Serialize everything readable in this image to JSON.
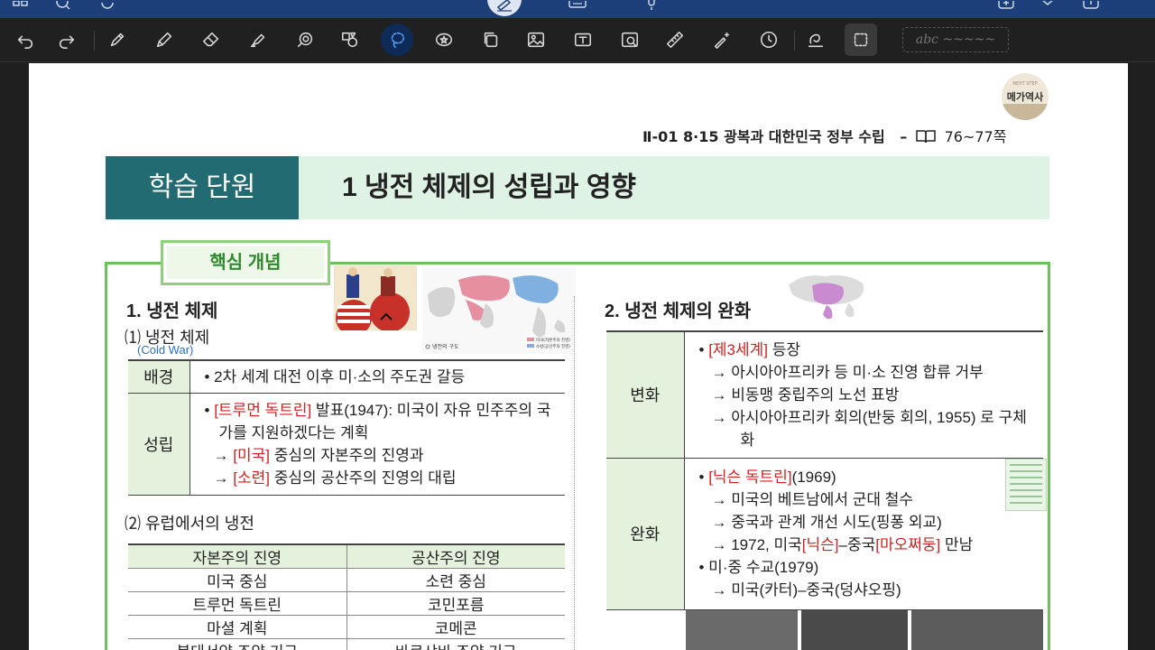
{
  "app": {
    "toolbar_placeholder": "abc ~~~~~",
    "icons": [
      "grid-icon",
      "search-icon",
      "rotate-icon",
      "pen-edit-icon",
      "doc-icon",
      "mic-icon",
      "add-page-icon",
      "bookmark-icon",
      "share-icon",
      "undo-icon",
      "redo-icon",
      "pen-icon",
      "pencil-icon",
      "eraser-icon",
      "highlighter-icon",
      "shape-icon",
      "shape-tools-icon",
      "lasso-icon",
      "sticker-icon",
      "copy-icon",
      "image-icon",
      "textbox-icon",
      "camera-image-icon",
      "ruler-icon",
      "laser-icon",
      "timer-icon",
      "handwriting-icon",
      "selection-icon"
    ]
  },
  "page": {
    "logo": {
      "small": "NEXT STEP",
      "text": "메가역사"
    },
    "reference": {
      "code": "Ⅱ-01 8·15 광복과 대한민국 정부 수립",
      "dash": "–",
      "pages": "76~77쪽"
    },
    "unit": {
      "label": "학습 단원",
      "title": "1 냉전 체제의 성립과 영향"
    },
    "concept_tab": "핵심 개념",
    "left": {
      "heading": "1. 냉전 체제",
      "sub1": "⑴ 냉전 체제",
      "sub1_en": "(Cold War)",
      "map_labels": {
        "caption": "냉전의 구도",
        "legend1": "미국(자본주의 진영)",
        "legend2": "소련(공산주의 진영)"
      },
      "table1": {
        "background_key": "배경",
        "background_text": "• 2차 세계 대전 이후 미·소의 주도권 갈등",
        "formation_key": "성립",
        "formation_line1_pre": "• ",
        "formation_line1_red": "[트루먼 독트린]",
        "formation_line1_post": " 발표(1947): 미국이 자유 민주주의 국가를 지원하겠다는 계획",
        "formation_line2_pre": "→ ",
        "formation_line2_red": "[미국]",
        "formation_line2_post": " 중심의 자본주의 진영과",
        "formation_line3_pre": "→ ",
        "formation_line3_red": "[소련]",
        "formation_line3_post": " 중심의 공산주의 진영의 대립"
      },
      "sub2": "⑵ 유럽에서의 냉전",
      "table2": {
        "headers": [
          "자본주의 진영",
          "공산주의 진영"
        ],
        "rows": [
          [
            "미국 중심",
            "소련 중심"
          ],
          [
            "트루먼 독트린",
            "코민포름"
          ],
          [
            "마셜 계획",
            "코메콘"
          ],
          [
            "북대서양 조약 기구",
            "바르샤바 조약 기구"
          ]
        ]
      }
    },
    "right": {
      "heading": "2. 냉전 체제의 완화",
      "table3": {
        "change_key": "변화",
        "c1_pre": "• ",
        "c1_red": "[제3세계]",
        "c1_post": " 등장",
        "c2": "→ 아시아아프리카 등 미·소 진영 합류 거부",
        "c3": "→ 비동맹 중립주의 노선 표방",
        "c4": "→ 아시아아프리카 회의(반둥 회의, 1955) 로 구체화",
        "ease_key": "완화",
        "e1_pre": "• ",
        "e1_red": "[닉슨 독트린]",
        "e1_post": "(1969)",
        "e2": "→ 미국의 베트남에서 군대 철수",
        "e3": "→ 중국과 관계 개선 시도(핑퐁 외교)",
        "e4_pre": "→ 1972, 미국",
        "e4_red1": "[닉슨]",
        "e4_mid": "–중국",
        "e4_red2": "[마오쩌둥]",
        "e4_post": " 만남",
        "e5": "• 미·중 수교(1979)",
        "e6": "→ 미국(카터)–중국(덩샤오핑)"
      }
    }
  },
  "colors": {
    "topbar": "#1c3f7a",
    "toolbar": "#202020",
    "unit_label_bg": "#226b72",
    "unit_bar_bg": "#dff3e4",
    "concept_green": "#6fbf5f",
    "answer_red": "#d42020",
    "lasso_blue": "#5aa2ff"
  }
}
